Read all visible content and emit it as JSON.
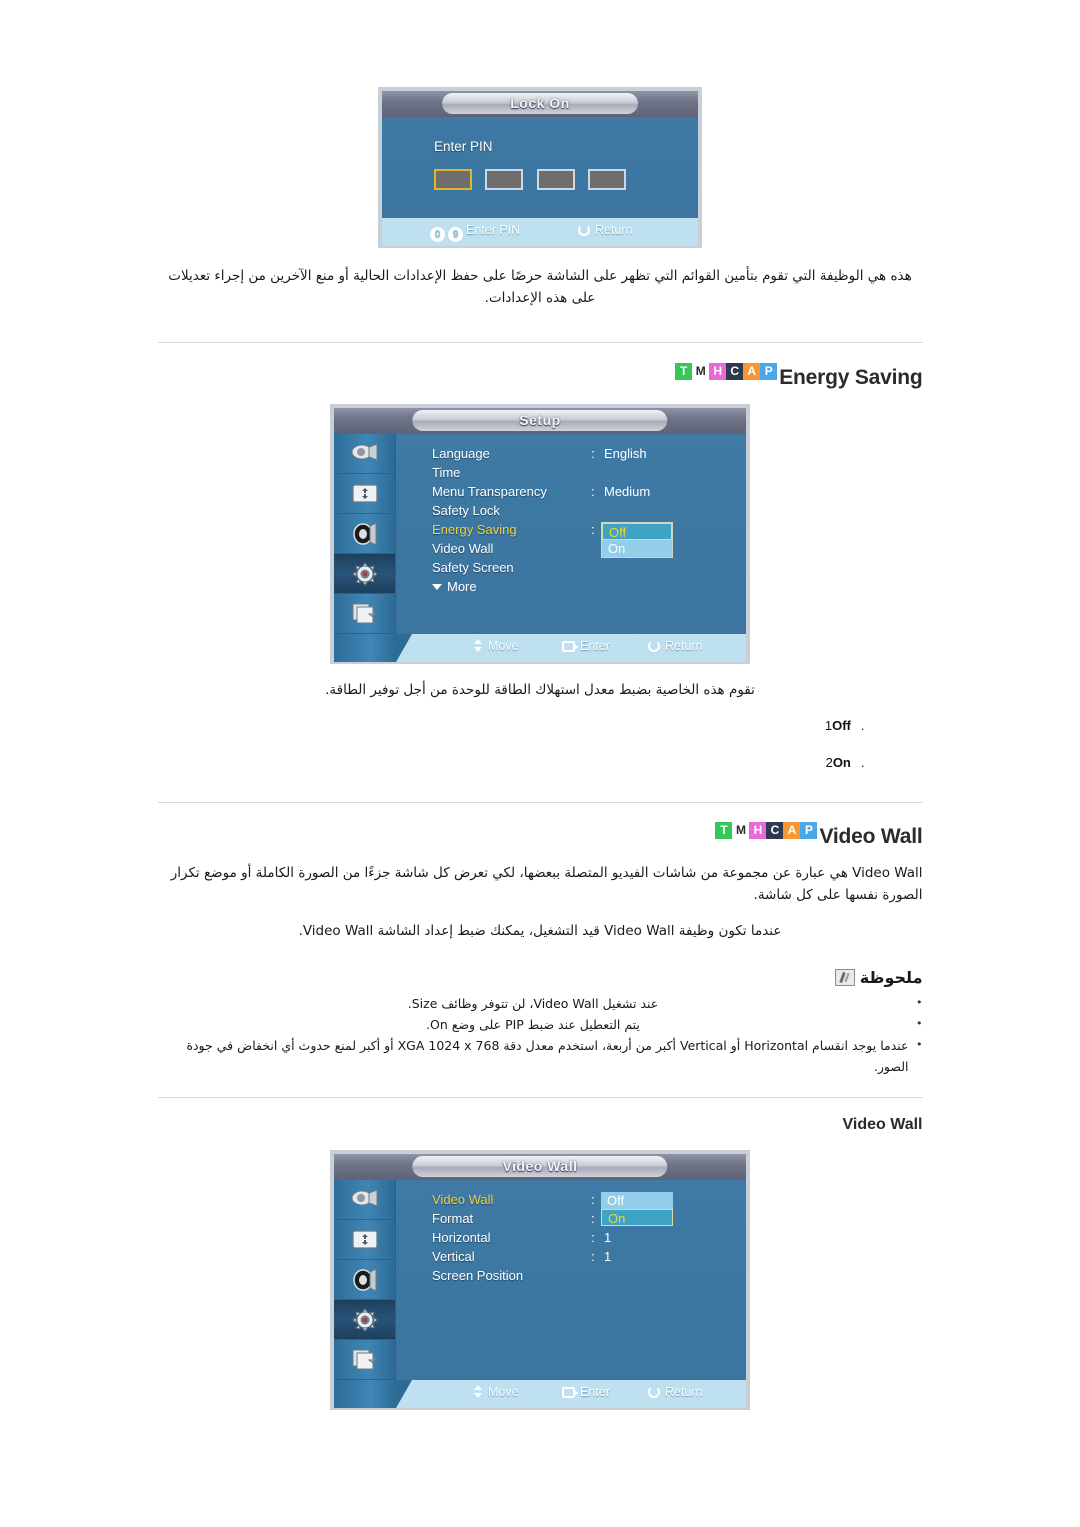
{
  "lock_dialog": {
    "title": "Lock On",
    "pin_label": "Enter PIN",
    "pin_boxes": [
      "",
      "",
      "",
      ""
    ],
    "footer": {
      "digit_1": "0",
      "digit_2": "9",
      "enter_pin": "Enter PIN",
      "return": "Return"
    }
  },
  "safety_lock_desc": "هذه هي الوظيفة التي تقوم بتأمين القوائم التي تظهر على الشاشة حرصًا على حفظ الإعدادات الحالية أو منع الآخرين من إجراء تعديلات على هذه الإعدادات.",
  "badges": [
    "T",
    "M",
    "H",
    "C",
    "A",
    "P"
  ],
  "energy_saving": {
    "heading": "Energy Saving",
    "menu": {
      "title": "Setup",
      "sidebar_icons": [
        "picture-icon",
        "screen-adjust-icon",
        "sound-icon",
        "setup-gear-icon",
        "multi-control-icon"
      ],
      "selected_sidebar_index": 3,
      "rows": [
        {
          "label": "Language",
          "colon": ":",
          "value": "English",
          "highlight": false
        },
        {
          "label": "Time",
          "colon": "",
          "value": "",
          "highlight": false
        },
        {
          "label": "Menu Transparency",
          "colon": ":",
          "value": "Medium",
          "highlight": false
        },
        {
          "label": "Safety Lock",
          "colon": "",
          "value": "",
          "highlight": false
        },
        {
          "label": "Energy Saving",
          "colon": ":",
          "value": "",
          "highlight": true
        },
        {
          "label": "Video Wall",
          "colon": "",
          "value": "",
          "highlight": false
        },
        {
          "label": "Safety Screen",
          "colon": "",
          "value": "",
          "highlight": false
        }
      ],
      "more_label": "More",
      "dropdown": {
        "current": "Off",
        "other": "On"
      },
      "footer": {
        "move": "Move",
        "enter": "Enter",
        "return": "Return"
      }
    },
    "description": "تقوم هذه الخاصية بضبط معدل استهلاك الطاقة للوحدة من أجل توفير الطاقة.",
    "options": [
      {
        "num": ".1",
        "value": "Off"
      },
      {
        "num": ".2",
        "value": "On"
      }
    ]
  },
  "video_wall": {
    "heading": "Video Wall",
    "desc_1": "Video Wall هي عبارة عن مجموعة من شاشات الفيديو المتصلة ببعضها، لكي تعرض كل شاشة جزءًا من الصورة الكاملة أو موضع تكرار الصورة نفسها على كل شاشة.",
    "desc_2": "عندما تكون وظيفة Video Wall قيد التشغيل، يمكنك ضبط إعداد الشاشة Video Wall.",
    "note_title": "ملحوظة",
    "notes": [
      "عند تشغيل Video Wall، لن تتوفر وظائف Size.",
      "يتم التعطيل عند ضبط PIP على وضع On.",
      "عندما يوجد انقسام Horizontal أو Vertical أكبر من أربعة، استخدم معدل دقة XGA 1024 x 768 أو أكبر لمنع حدوث أي انخفاض في جودة الصور."
    ],
    "subheading": "Video Wall",
    "menu": {
      "title": "Video Wall",
      "sidebar_icons": [
        "picture-icon",
        "screen-adjust-icon",
        "sound-icon",
        "setup-gear-icon",
        "multi-control-icon"
      ],
      "selected_sidebar_index": 3,
      "rows": [
        {
          "label": "Video Wall",
          "colon": ":",
          "value": "",
          "highlight": true
        },
        {
          "label": "Format",
          "colon": ":",
          "value": "",
          "highlight": false
        },
        {
          "label": "Horizontal",
          "colon": ":",
          "value": "1",
          "highlight": false
        },
        {
          "label": "Vertical",
          "colon": ":",
          "value": "1",
          "highlight": false
        },
        {
          "label": "Screen Position",
          "colon": "",
          "value": "",
          "highlight": false
        }
      ],
      "dropdown": {
        "top": "Off",
        "current": "On"
      },
      "footer": {
        "move": "Move",
        "enter": "Enter",
        "return": "Return"
      }
    }
  },
  "colors": {
    "osd_blue": "#3d78a3",
    "highlight_yellow": "#f3d13a",
    "footer_bar": "#bfe0f0",
    "badge_t": "#34c759",
    "badge_m": "#ffffff",
    "badge_h": "#e86ad6",
    "badge_c": "#2f3a52",
    "badge_a": "#f79632",
    "badge_p": "#4aa8e8"
  }
}
